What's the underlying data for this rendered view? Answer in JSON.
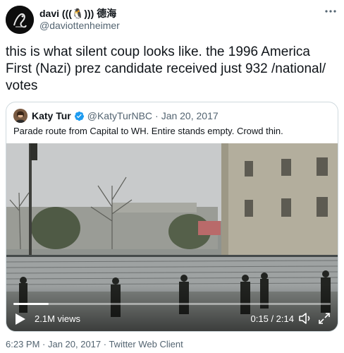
{
  "author": {
    "display_name": "davi (((🐧))) 德海",
    "handle": "@daviottenheimer",
    "avatar_icon": "avatar-icon"
  },
  "tweet": {
    "text": "this is what silent coup looks like. the 1996 America First (Nazi) prez candidate received just 932 /national/ votes"
  },
  "quoted_tweet": {
    "display_name": "Katy Tur",
    "verified": true,
    "handle": "@KatyTurNBC",
    "separator": "·",
    "date": "Jan 20, 2017",
    "text": "Parade route from Capital to WH. Entire stands empty. Crowd thin."
  },
  "video": {
    "views": "2.1M views",
    "time": "0:15 / 2:14",
    "progress_fraction": 0.112
  },
  "footer": {
    "timestamp": "6:23 PM · Jan 20, 2017 · Twitter Web Client"
  },
  "colors": {
    "text": "#0f1419",
    "secondary": "#536471",
    "border": "#cfd9de",
    "verified_blue": "#1d9bf0"
  }
}
